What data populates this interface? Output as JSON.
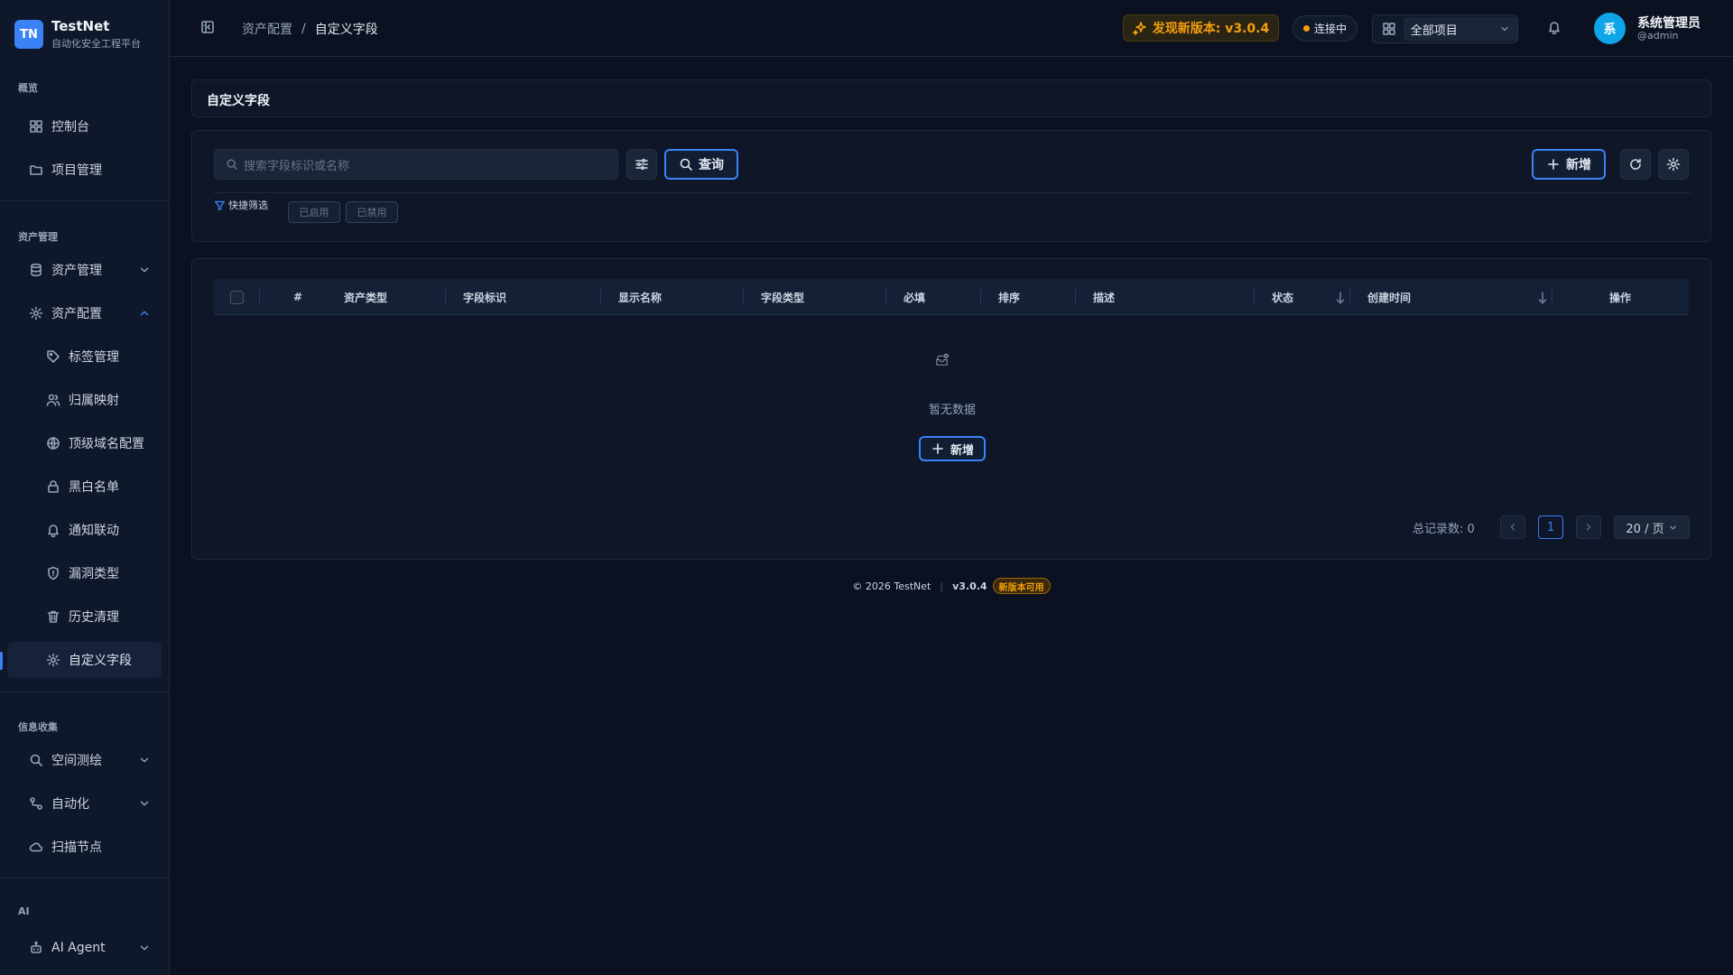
{
  "brand": {
    "logo": "TN",
    "name": "TestNet",
    "subtitle": "自动化安全工程平台"
  },
  "sidebar": {
    "sections": [
      {
        "label": "概览"
      },
      {
        "label": "资产管理"
      },
      {
        "label": "信息收集"
      },
      {
        "label": "AI"
      }
    ],
    "items": [
      {
        "label": "控制台",
        "icon": "dashboard-icon"
      },
      {
        "label": "项目管理",
        "icon": "folder-icon"
      },
      {
        "label": "资产管理",
        "icon": "database-icon",
        "expanded": false
      },
      {
        "label": "资产配置",
        "icon": "gear-icon",
        "expanded": true
      },
      {
        "label": "标签管理",
        "icon": "tag-icon"
      },
      {
        "label": "归属映射",
        "icon": "users-icon"
      },
      {
        "label": "顶级域名配置",
        "icon": "globe-icon"
      },
      {
        "label": "黑白名单",
        "icon": "lock-icon"
      },
      {
        "label": "通知联动",
        "icon": "bell-icon"
      },
      {
        "label": "漏洞类型",
        "icon": "shield-icon"
      },
      {
        "label": "历史清理",
        "icon": "trash-icon"
      },
      {
        "label": "自定义字段",
        "icon": "gear-icon",
        "active": true
      },
      {
        "label": "空间测绘",
        "icon": "search-icon",
        "expanded": false
      },
      {
        "label": "自动化",
        "icon": "workflow-icon",
        "expanded": false
      },
      {
        "label": "扫描节点",
        "icon": "cloud-icon"
      },
      {
        "label": "AI Agent",
        "icon": "robot-icon",
        "expanded": false
      }
    ]
  },
  "topbar": {
    "breadcrumb": [
      "资产配置",
      "自定义字段"
    ],
    "breadcrumb_sep": "/",
    "update_notice": "发现新版本: v3.0.4",
    "connection_status": "连接中",
    "project_selector": "全部项目",
    "user": {
      "avatar": "系",
      "name": "系统管理员",
      "handle": "@admin"
    }
  },
  "page": {
    "title": "自定义字段",
    "search": {
      "placeholder": "搜索字段标识或名称",
      "value": ""
    },
    "query_button": "查询",
    "add_button": "新增",
    "quick_filter_label": "快捷筛选",
    "quick_filters": [
      "已启用",
      "已禁用"
    ],
    "table": {
      "columns": [
        "#",
        "资产类型",
        "字段标识",
        "显示名称",
        "字段类型",
        "必填",
        "排序",
        "描述",
        "状态",
        "创建时间",
        "操作"
      ],
      "rows": []
    },
    "empty_text": "暂无数据",
    "empty_add_button": "新增",
    "pagination": {
      "total_label": "总记录数: 0",
      "current_page": "1",
      "page_size": "20 / 页"
    }
  },
  "footer": {
    "copyright": "© 2026 TestNet",
    "separator": "|",
    "version": "v3.0.4",
    "badge": "新版本可用"
  },
  "colors": {
    "accent": "#3b82f6",
    "warning": "#f59e0b",
    "background": "#0b1120",
    "sidebar": "#0f172a"
  }
}
